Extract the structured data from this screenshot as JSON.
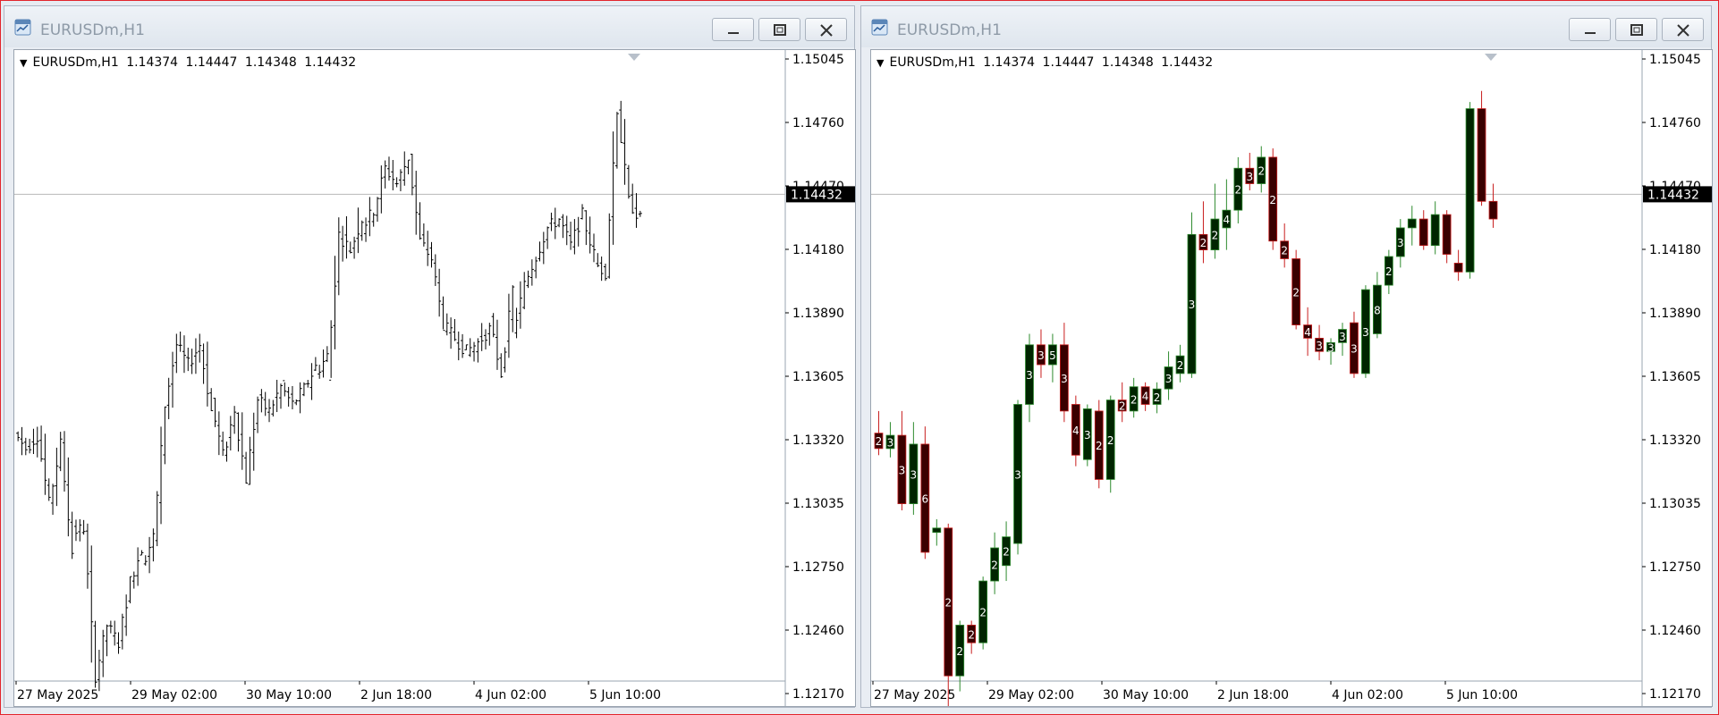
{
  "windows": [
    {
      "title": "EURUSDm,H1",
      "info": {
        "symbol": "EURUSDm,H1",
        "open": "1.14374",
        "high": "1.14447",
        "low": "1.14348",
        "close": "1.14432"
      },
      "style": "bars"
    },
    {
      "title": "EURUSDm,H1",
      "info": {
        "symbol": "EURUSDm,H1",
        "open": "1.14374",
        "high": "1.14447",
        "low": "1.14348",
        "close": "1.14432"
      },
      "style": "candles"
    }
  ],
  "price_axis": {
    "ticks": [
      "1.15045",
      "1.14760",
      "1.14470",
      "1.14180",
      "1.13890",
      "1.13605",
      "1.13320",
      "1.13035",
      "1.12750",
      "1.12460",
      "1.12170"
    ],
    "current_price": "1.14432"
  },
  "time_axis": {
    "labels": [
      "27 May 2025",
      "29 May 02:00",
      "30 May 10:00",
      "2 Jun 18:00",
      "4 Jun 02:00",
      "5 Jun 10:00"
    ]
  },
  "colors": {
    "bull_body": "#002500",
    "bear_body": "#3a0000",
    "bull_wick": "#2e8b2e",
    "bear_wick": "#c81e1e",
    "bar_line": "#000000",
    "grid_line": "#b8b8b8",
    "accent_red": "#e3242b"
  },
  "icons": {
    "app": "chart-window-icon",
    "minimize": "minimize-icon",
    "maximize": "maximize-icon",
    "close": "close-icon"
  },
  "chart_data": {
    "type": "candlestick",
    "symbol": "EURUSDm",
    "timeframe": "H1",
    "ylim": [
      1.1195,
      1.1525
    ],
    "right_window_candle_labels": [
      {
        "i": 0,
        "label": "2"
      },
      {
        "i": 1,
        "label": "3"
      },
      {
        "i": 2,
        "label": "3"
      },
      {
        "i": 3,
        "label": "3"
      },
      {
        "i": 4,
        "label": "6"
      },
      {
        "i": 5,
        "label": "2"
      },
      {
        "i": 6,
        "label": "2"
      },
      {
        "i": 7,
        "label": "2"
      },
      {
        "i": 8,
        "label": "2"
      },
      {
        "i": 9,
        "label": "2"
      },
      {
        "i": 10,
        "label": "2"
      },
      {
        "i": 11,
        "label": "2"
      },
      {
        "i": 12,
        "label": "3"
      },
      {
        "i": 13,
        "label": "3"
      },
      {
        "i": 14,
        "label": "3"
      },
      {
        "i": 15,
        "label": "5"
      },
      {
        "i": 16,
        "label": "3"
      },
      {
        "i": 17,
        "label": "4"
      },
      {
        "i": 18,
        "label": "3"
      },
      {
        "i": 19,
        "label": "2"
      },
      {
        "i": 20,
        "label": "2"
      },
      {
        "i": 21,
        "label": "2"
      },
      {
        "i": 22,
        "label": "2"
      },
      {
        "i": 23,
        "label": "4"
      },
      {
        "i": 24,
        "label": "2"
      },
      {
        "i": 25,
        "label": "3"
      },
      {
        "i": 26,
        "label": "2"
      },
      {
        "i": 27,
        "label": "3"
      },
      {
        "i": 28,
        "label": "2"
      },
      {
        "i": 29,
        "label": "2"
      },
      {
        "i": 30,
        "label": "4"
      },
      {
        "i": 31,
        "label": "2"
      },
      {
        "i": 32,
        "label": "3"
      },
      {
        "i": 33,
        "label": "2"
      },
      {
        "i": 34,
        "label": "2"
      },
      {
        "i": 35,
        "label": "2"
      },
      {
        "i": 36,
        "label": "2"
      },
      {
        "i": 37,
        "label": "4"
      },
      {
        "i": 38,
        "label": "3"
      },
      {
        "i": 39,
        "label": "3"
      },
      {
        "i": 40,
        "label": "3"
      },
      {
        "i": 41,
        "label": "3"
      },
      {
        "i": 42,
        "label": "3"
      },
      {
        "i": 43,
        "label": "8"
      },
      {
        "i": 44,
        "label": "2"
      },
      {
        "i": 45,
        "label": "3"
      }
    ],
    "right_window_candles": [
      {
        "o": 1.1335,
        "h": 1.1345,
        "l": 1.1325,
        "c": 1.1328
      },
      {
        "o": 1.1328,
        "h": 1.134,
        "l": 1.1324,
        "c": 1.1334
      },
      {
        "o": 1.1334,
        "h": 1.1345,
        "l": 1.13,
        "c": 1.1303
      },
      {
        "o": 1.1303,
        "h": 1.134,
        "l": 1.1298,
        "c": 1.133
      },
      {
        "o": 1.133,
        "h": 1.1338,
        "l": 1.1278,
        "c": 1.1281
      },
      {
        "o": 1.129,
        "h": 1.1296,
        "l": 1.1284,
        "c": 1.1292
      },
      {
        "o": 1.1292,
        "h": 1.1294,
        "l": 1.121,
        "c": 1.1225
      },
      {
        "o": 1.1225,
        "h": 1.125,
        "l": 1.1218,
        "c": 1.1248
      },
      {
        "o": 1.1248,
        "h": 1.125,
        "l": 1.1235,
        "c": 1.124
      },
      {
        "o": 1.124,
        "h": 1.127,
        "l": 1.1237,
        "c": 1.1268
      },
      {
        "o": 1.1268,
        "h": 1.129,
        "l": 1.1262,
        "c": 1.1283
      },
      {
        "o": 1.1275,
        "h": 1.1295,
        "l": 1.1268,
        "c": 1.1288
      },
      {
        "o": 1.1285,
        "h": 1.135,
        "l": 1.128,
        "c": 1.1348
      },
      {
        "o": 1.1348,
        "h": 1.138,
        "l": 1.134,
        "c": 1.1375
      },
      {
        "o": 1.1375,
        "h": 1.1382,
        "l": 1.136,
        "c": 1.1366
      },
      {
        "o": 1.1366,
        "h": 1.138,
        "l": 1.1358,
        "c": 1.1375
      },
      {
        "o": 1.1375,
        "h": 1.1385,
        "l": 1.134,
        "c": 1.1345
      },
      {
        "o": 1.1348,
        "h": 1.1352,
        "l": 1.132,
        "c": 1.1325
      },
      {
        "o": 1.1323,
        "h": 1.1348,
        "l": 1.132,
        "c": 1.1346
      },
      {
        "o": 1.1345,
        "h": 1.135,
        "l": 1.131,
        "c": 1.1314
      },
      {
        "o": 1.1314,
        "h": 1.1352,
        "l": 1.1308,
        "c": 1.135
      },
      {
        "o": 1.135,
        "h": 1.1358,
        "l": 1.134,
        "c": 1.1345
      },
      {
        "o": 1.1345,
        "h": 1.136,
        "l": 1.1342,
        "c": 1.1356
      },
      {
        "o": 1.1356,
        "h": 1.1358,
        "l": 1.1345,
        "c": 1.1348
      },
      {
        "o": 1.1348,
        "h": 1.1358,
        "l": 1.1344,
        "c": 1.1355
      },
      {
        "o": 1.1355,
        "h": 1.1372,
        "l": 1.135,
        "c": 1.1365
      },
      {
        "o": 1.1362,
        "h": 1.1375,
        "l": 1.1358,
        "c": 1.137
      },
      {
        "o": 1.1362,
        "h": 1.1435,
        "l": 1.136,
        "c": 1.1425
      },
      {
        "o": 1.1425,
        "h": 1.144,
        "l": 1.1412,
        "c": 1.1418
      },
      {
        "o": 1.1418,
        "h": 1.1448,
        "l": 1.1414,
        "c": 1.1432
      },
      {
        "o": 1.1428,
        "h": 1.145,
        "l": 1.1418,
        "c": 1.1436
      },
      {
        "o": 1.1436,
        "h": 1.146,
        "l": 1.143,
        "c": 1.1455
      },
      {
        "o": 1.1455,
        "h": 1.1462,
        "l": 1.1445,
        "c": 1.1448
      },
      {
        "o": 1.1448,
        "h": 1.1465,
        "l": 1.1444,
        "c": 1.146
      },
      {
        "o": 1.146,
        "h": 1.1464,
        "l": 1.1418,
        "c": 1.1422
      },
      {
        "o": 1.1422,
        "h": 1.143,
        "l": 1.141,
        "c": 1.1414
      },
      {
        "o": 1.1414,
        "h": 1.1418,
        "l": 1.1382,
        "c": 1.1384
      },
      {
        "o": 1.1384,
        "h": 1.1392,
        "l": 1.137,
        "c": 1.1378
      },
      {
        "o": 1.1378,
        "h": 1.1384,
        "l": 1.1368,
        "c": 1.1372
      },
      {
        "o": 1.1372,
        "h": 1.1378,
        "l": 1.1366,
        "c": 1.1376
      },
      {
        "o": 1.1376,
        "h": 1.1385,
        "l": 1.137,
        "c": 1.1382
      },
      {
        "o": 1.1385,
        "h": 1.139,
        "l": 1.136,
        "c": 1.1362
      },
      {
        "o": 1.1362,
        "h": 1.1402,
        "l": 1.136,
        "c": 1.14
      },
      {
        "o": 1.138,
        "h": 1.1408,
        "l": 1.1378,
        "c": 1.1402
      },
      {
        "o": 1.1402,
        "h": 1.1418,
        "l": 1.1398,
        "c": 1.1415
      },
      {
        "o": 1.1415,
        "h": 1.1432,
        "l": 1.141,
        "c": 1.1428
      },
      {
        "o": 1.1428,
        "h": 1.1438,
        "l": 1.142,
        "c": 1.1432
      },
      {
        "o": 1.1432,
        "h": 1.1436,
        "l": 1.1418,
        "c": 1.142
      },
      {
        "o": 1.142,
        "h": 1.144,
        "l": 1.1416,
        "c": 1.1434
      },
      {
        "o": 1.1434,
        "h": 1.1436,
        "l": 1.1412,
        "c": 1.1416
      },
      {
        "o": 1.1412,
        "h": 1.1418,
        "l": 1.1404,
        "c": 1.1408
      },
      {
        "o": 1.1408,
        "h": 1.1485,
        "l": 1.1405,
        "c": 1.1482
      },
      {
        "o": 1.1482,
        "h": 1.149,
        "l": 1.1438,
        "c": 1.144
      },
      {
        "o": 1.144,
        "h": 1.1448,
        "l": 1.1428,
        "c": 1.1432
      }
    ]
  }
}
